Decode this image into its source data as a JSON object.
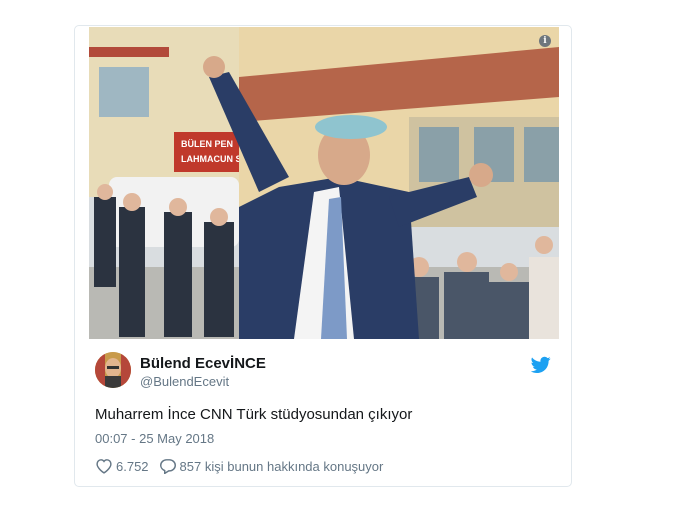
{
  "tweet": {
    "display_name": "Bülend EcevİNCE",
    "handle": "@BulendEcevit",
    "text": "Muharrem İnce CNN Türk stüdyosundan çıkıyor",
    "timestamp": "00:07 - 25 May 2018",
    "likes": "6.752",
    "conversation": "857 kişi bunun hakkında konuşuyor"
  },
  "media": {
    "sign_text_1": "BÜLEN PEN",
    "sign_text_2": "LAHMACUN SALO"
  },
  "icons": {
    "info": "info-icon",
    "bird": "twitter-bird-icon",
    "like": "heart-icon",
    "reply": "speech-bubble-icon"
  },
  "colors": {
    "twitter_blue": "#1da1f2",
    "text": "#14171a",
    "secondary": "#657786",
    "border": "#e1e8ed"
  }
}
